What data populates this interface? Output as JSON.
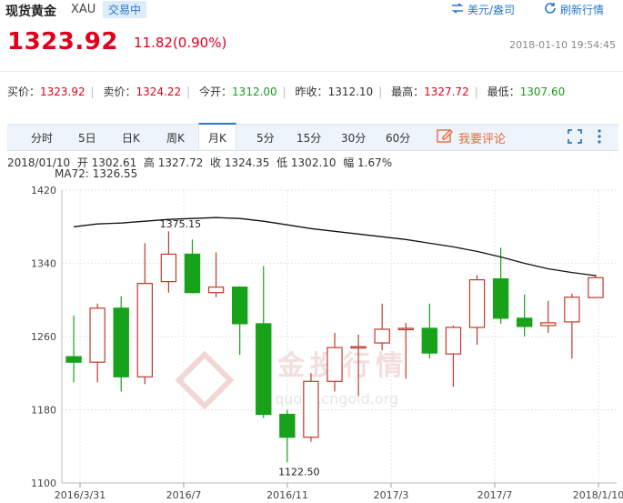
{
  "header": {
    "title": "现货黄金",
    "code": "XAU",
    "status": "交易中",
    "currency_link": "美元/盎司",
    "refresh_link": "刷新行情",
    "price": "1323.92",
    "change": "11.82(0.90%)",
    "datetime": "2018-01-10 19:54:45"
  },
  "quotes": {
    "buy_label": "买价：",
    "buy": "1323.92",
    "sell_label": "卖价：",
    "sell": "1324.22",
    "open_label": "今开：",
    "open": "1312.00",
    "prev_label": "昨收：",
    "prev": "1312.10",
    "high_label": "最高：",
    "high": "1327.72",
    "low_label": "最低：",
    "low": "1307.60"
  },
  "tabs": [
    "分时",
    "5日",
    "日K",
    "周K",
    "月K",
    "5分",
    "15分",
    "30分",
    "60分"
  ],
  "active_tab": "月K",
  "comment_label": "我要评论",
  "colors": {
    "up": "#c0392b",
    "down": "#17a21a",
    "accent": "#2a77c9",
    "price": "#e0001b"
  },
  "info": {
    "date": "2018/01/10",
    "open": "开 1302.61",
    "high": "高 1327.72",
    "close": "收 1324.35",
    "low": "低 1302.10",
    "range": "幅 1.67%",
    "ma": "MA72: 1326.55"
  },
  "watermark": {
    "text": "金投行情",
    "url": "quote.cngold.org"
  },
  "chart_data": {
    "type": "candlestick",
    "ylim": [
      1100,
      1420
    ],
    "yticks": [
      "1420",
      "1340",
      "1260",
      "1180",
      "1100"
    ],
    "xticks": [
      "2016/3/31",
      "2016/7",
      "2016/11",
      "2017/3",
      "2017/7",
      "2018/1/10"
    ],
    "annotations": [
      {
        "label": "1375.15",
        "index": 4,
        "value": 1375.15
      },
      {
        "label": "1122.50",
        "index": 9,
        "value": 1122.5
      }
    ],
    "candles": [
      {
        "x": "2016/3",
        "open": 1238,
        "close": 1232,
        "high": 1283,
        "low": 1210
      },
      {
        "x": "2016/4",
        "open": 1232,
        "close": 1291,
        "high": 1296,
        "low": 1210
      },
      {
        "x": "2016/5",
        "open": 1291,
        "close": 1216,
        "high": 1304,
        "low": 1200
      },
      {
        "x": "2016/6",
        "open": 1216,
        "close": 1318,
        "high": 1362,
        "low": 1208
      },
      {
        "x": "2016/7",
        "open": 1320,
        "close": 1350,
        "high": 1375,
        "low": 1308
      },
      {
        "x": "2016/8",
        "open": 1350,
        "close": 1308,
        "high": 1366,
        "low": 1307
      },
      {
        "x": "2016/9",
        "open": 1308,
        "close": 1314,
        "high": 1352,
        "low": 1303
      },
      {
        "x": "2016/10",
        "open": 1314,
        "close": 1274,
        "high": 1315,
        "low": 1240
      },
      {
        "x": "2016/11",
        "open": 1274,
        "close": 1175,
        "high": 1337,
        "low": 1171
      },
      {
        "x": "2016/12",
        "open": 1175,
        "close": 1150,
        "high": 1180,
        "low": 1122.5
      },
      {
        "x": "2017/1",
        "open": 1150,
        "close": 1211,
        "high": 1220,
        "low": 1145
      },
      {
        "x": "2017/2",
        "open": 1211,
        "close": 1248,
        "high": 1264,
        "low": 1200
      },
      {
        "x": "2017/3",
        "open": 1248,
        "close": 1249,
        "high": 1262,
        "low": 1195
      },
      {
        "x": "2017/4",
        "open": 1253,
        "close": 1268,
        "high": 1296,
        "low": 1245
      },
      {
        "x": "2017/5",
        "open": 1268,
        "close": 1269,
        "high": 1275,
        "low": 1214
      },
      {
        "x": "2017/6",
        "open": 1269,
        "close": 1242,
        "high": 1296,
        "low": 1236
      },
      {
        "x": "2017/7",
        "open": 1241,
        "close": 1270,
        "high": 1272,
        "low": 1205
      },
      {
        "x": "2017/8",
        "open": 1270,
        "close": 1322,
        "high": 1327,
        "low": 1251
      },
      {
        "x": "2017/9",
        "open": 1323,
        "close": 1280,
        "high": 1357,
        "low": 1274
      },
      {
        "x": "2017/10",
        "open": 1280,
        "close": 1271,
        "high": 1306,
        "low": 1260
      },
      {
        "x": "2017/11",
        "open": 1272,
        "close": 1275,
        "high": 1299,
        "low": 1264
      },
      {
        "x": "2017/12",
        "open": 1276,
        "close": 1303,
        "high": 1307,
        "low": 1236
      },
      {
        "x": "2018/1",
        "open": 1302.61,
        "close": 1324.35,
        "high": 1327.72,
        "low": 1302.1
      }
    ],
    "ma72": [
      1380,
      1383,
      1384,
      1386,
      1388,
      1389,
      1390,
      1389,
      1386,
      1382,
      1378,
      1375,
      1372,
      1369,
      1366,
      1362,
      1358,
      1353,
      1347,
      1340,
      1334,
      1330,
      1326.55
    ]
  }
}
